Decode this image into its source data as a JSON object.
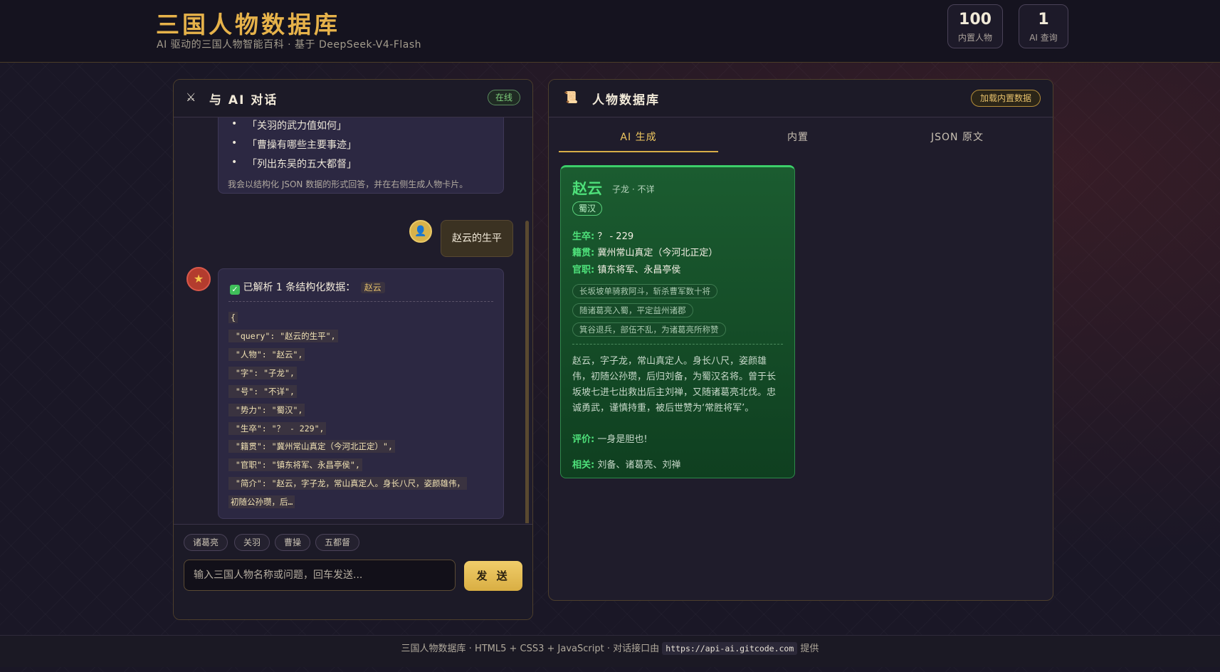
{
  "header": {
    "title": "三国人物数据库",
    "subtitle": "AI 驱动的三国人物智能百科 · 基于 DeepSeek-V4-Flash",
    "stats": [
      {
        "value": "100",
        "label": "内置人物"
      },
      {
        "value": "1",
        "label": "AI 查询"
      }
    ]
  },
  "chat_panel": {
    "icon": "crossed-swords-icon",
    "title": "与 AI 对话",
    "status": "在线",
    "intro_examples": [
      "「关羽的武力值如何」",
      "「曹操有哪些主要事迹」",
      "「列出东吴的五大都督」"
    ],
    "intro_note": "我会以结构化 JSON 数据的形式回答，并在右侧生成人物卡片。",
    "user_message": "赵云的生平",
    "result_header": "已解析 1 条结构化数据：",
    "result_tag": "赵云",
    "json_lines": [
      "{",
      " \"query\": \"赵云的生平\",",
      " \"人物\": \"赵云\",",
      " \"字\": \"子龙\",",
      " \"号\": \"不详\",",
      " \"势力\": \"蜀汉\",",
      " \"生卒\": \"？ - 229\",",
      " \"籍贯\": \"冀州常山真定（今河北正定）\",",
      " \"官职\": \"镇东将军、永昌亭侯\",",
      " \"简介\": \"赵云，字子龙，常山真定人。身长八尺，姿颜雄伟，",
      "初随公孙瓒，后…"
    ],
    "chips": [
      "诸葛亮",
      "关羽",
      "曹操",
      "五都督"
    ],
    "input_placeholder": "输入三国人物名称或问题，回车发送...",
    "send_label": "发 送"
  },
  "db_panel": {
    "icon": "scroll-icon",
    "title": "人物数据库",
    "load_button": "加载内置数据",
    "tabs": [
      "AI 生成",
      "内置",
      "JSON 原文"
    ],
    "active_tab": "AI 生成",
    "card": {
      "name": "赵云",
      "alias": "子龙 · 不详",
      "faction": "蜀汉",
      "fields": [
        {
          "label": "生卒:",
          "value": "？ - 229"
        },
        {
          "label": "籍贯:",
          "value": "冀州常山真定（今河北正定）"
        },
        {
          "label": "官职:",
          "value": "镇东将军、永昌亭侯"
        }
      ],
      "deeds": [
        "长坂坡单骑救阿斗，斩杀曹军数十将",
        "随诸葛亮入蜀，平定益州诸郡",
        "箕谷退兵，部伍不乱，为诸葛亮所称赞"
      ],
      "bio": "赵云，字子龙，常山真定人。身长八尺，姿颜雄伟，初随公孙瓒，后归刘备，为蜀汉名将。曾于长坂坡七进七出救出后主刘禅，又随诸葛亮北伐。忠诚勇武，谨慎持重，被后世赞为‘常胜将军’。",
      "evaluation_label": "评价:",
      "evaluation": "一身是胆也!",
      "related_label": "相关:",
      "related": "刘备、诸葛亮、刘禅",
      "colors": {
        "accent": "#4ee07a",
        "background": "#1b5c30"
      }
    }
  },
  "footer": {
    "text_before": "三国人物数据库 · HTML5 + CSS3 + JavaScript · 对话接口由",
    "api_url": "https://api-ai.gitcode.com",
    "text_after": "提供"
  },
  "colors": {
    "brand_gold": "#e6b24a",
    "online_green": "#7fcf7c"
  }
}
